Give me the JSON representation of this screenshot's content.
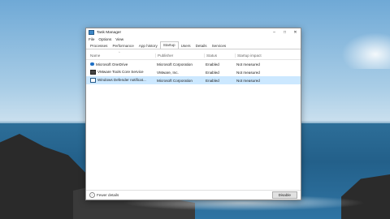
{
  "window": {
    "title": "Task Manager",
    "controls": {
      "minimize": "–",
      "maximize": "□",
      "close": "✕"
    }
  },
  "menu": [
    "File",
    "Options",
    "View"
  ],
  "tabs": [
    "Processes",
    "Performance",
    "App history",
    "Startup",
    "Users",
    "Details",
    "Services"
  ],
  "active_tab": "Startup",
  "columns": {
    "name": "Name",
    "publisher": "Publisher",
    "status": "Status",
    "impact": "Startup impact",
    "sort_indicator": "^"
  },
  "rows": [
    {
      "icon": "onedrive-icon",
      "name": "Microsoft OneDrive",
      "publisher": "Microsoft Corporation",
      "status": "Enabled",
      "impact": "Not measured"
    },
    {
      "icon": "vmware-icon",
      "name": "VMware Tools Core Service",
      "publisher": "VMware, Inc.",
      "status": "Enabled",
      "impact": "Not measured"
    },
    {
      "icon": "defender-icon",
      "name": "Windows Defender notificat...",
      "publisher": "Microsoft Corporation",
      "status": "Enabled",
      "impact": "Not measured"
    }
  ],
  "footer": {
    "fewer_details": "Fewer details",
    "action_button": "Disable",
    "chevron": "^"
  }
}
